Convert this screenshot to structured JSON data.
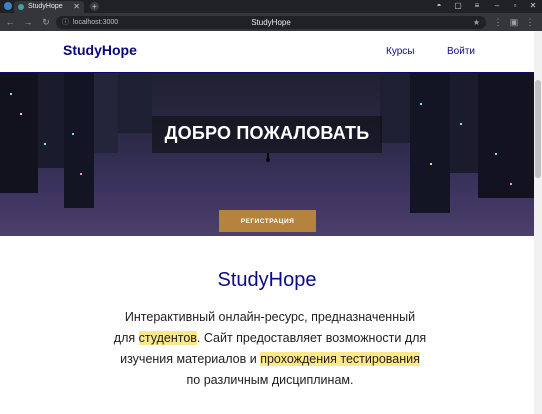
{
  "browser": {
    "tab_title": "StudyHope",
    "tab_close": "✕",
    "new_tab": "+",
    "url": "localhost:3000",
    "content_title": "StudyHope"
  },
  "site": {
    "brand": "StudyHope",
    "nav": [
      {
        "label": "Курсы"
      },
      {
        "label": "Войти"
      }
    ]
  },
  "hero": {
    "heading": "ДОБРО ПОЖАЛОВАТЬ",
    "register_label": "РЕГИСТРАЦИЯ"
  },
  "about": {
    "title": "StudyHope",
    "line1": "Интерактивный онлайн-ресурс, предназначенный",
    "line2_pre": "для ",
    "line2_hl": "студентов",
    "line2_post": ". Сайт предоставляет возможности для",
    "line3_pre": "изучения материалов и ",
    "line3_hl": "прохождения тестирования",
    "line4": "по различным дисциплинам."
  },
  "colors": {
    "brand": "#07077a",
    "button": "#b5833d",
    "highlight": "#fde98a"
  }
}
